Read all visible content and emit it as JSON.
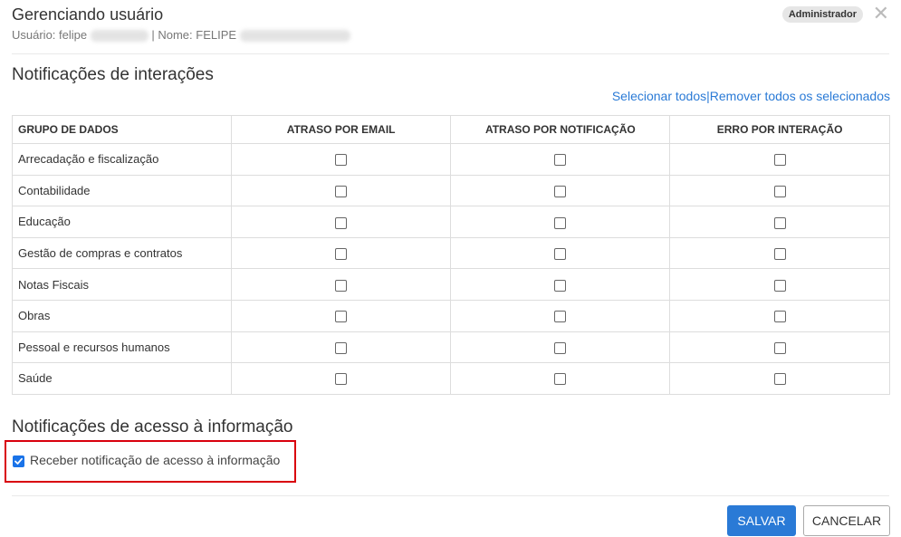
{
  "header": {
    "title": "Gerenciando usuário",
    "user_label": "Usuário: felipe",
    "separator": "| Nome: FELIPE",
    "role_badge": "Administrador"
  },
  "interactions": {
    "title": "Notificações de interações",
    "select_all": "Selecionar todos",
    "link_sep": "|",
    "remove_all": "Remover todos os selecionados",
    "columns": [
      "GRUPO DE DADOS",
      "ATRASO POR EMAIL",
      "ATRASO POR NOTIFICAÇÃO",
      "ERRO POR INTERAÇÃO"
    ],
    "rows": [
      "Arrecadação e fiscalização",
      "Contabilidade",
      "Educação",
      "Gestão de compras e contratos",
      "Notas Fiscais",
      "Obras",
      "Pessoal e recursos humanos",
      "Saúde"
    ]
  },
  "access": {
    "title": "Notificações de acesso à informação",
    "checkbox_label": "Receber notificação de acesso à informação",
    "checked": true
  },
  "footer": {
    "save": "SALVAR",
    "cancel": "CANCELAR"
  },
  "colors": {
    "accent": "#2a7ad6",
    "highlight_border": "#d9000d"
  }
}
